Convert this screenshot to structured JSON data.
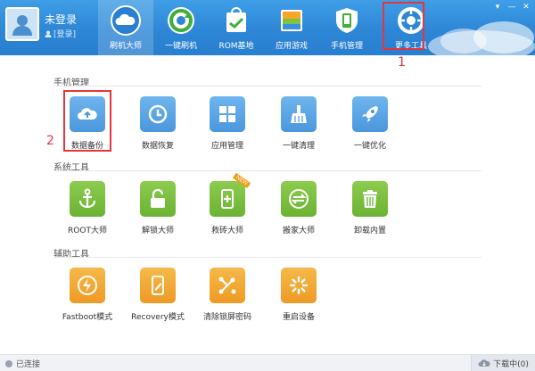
{
  "header": {
    "user_name": "未登录",
    "login_link": "[登录]",
    "tabs": [
      {
        "label": "刷机大师",
        "icon": "cloud-icon",
        "active": true
      },
      {
        "label": "一键刷机",
        "icon": "refresh-icon",
        "active": false
      },
      {
        "label": "ROM基地",
        "icon": "rom-bag-icon",
        "active": false
      },
      {
        "label": "应用游戏",
        "icon": "apps-icon",
        "active": false
      },
      {
        "label": "手机管理",
        "icon": "phone-shield-icon",
        "active": false
      },
      {
        "label": "更多工具",
        "icon": "gear-icon",
        "active": false
      }
    ],
    "window_controls": [
      "▾",
      "—",
      "✕"
    ]
  },
  "annotations": {
    "step1": "1",
    "step2": "2"
  },
  "sections": [
    {
      "title": "手机管理",
      "tools": [
        {
          "label": "数据备份",
          "icon": "cloud-upload-icon",
          "color": "#4a97dc"
        },
        {
          "label": "数据恢复",
          "icon": "clock-icon",
          "color": "#4a97dc"
        },
        {
          "label": "应用管理",
          "icon": "grid-icon",
          "color": "#4a97dc"
        },
        {
          "label": "一键清理",
          "icon": "broom-icon",
          "color": "#4a97dc"
        },
        {
          "label": "一键优化",
          "icon": "rocket-icon",
          "color": "#4a97dc"
        }
      ]
    },
    {
      "title": "系统工具",
      "tools": [
        {
          "label": "ROOT大师",
          "icon": "anchor-icon",
          "color": "#6bb233"
        },
        {
          "label": "解锁大师",
          "icon": "unlock-icon",
          "color": "#6bb233"
        },
        {
          "label": "救砖大师",
          "icon": "phone-plus-icon",
          "color": "#6bb233",
          "badge": "NEW"
        },
        {
          "label": "搬家大师",
          "icon": "transfer-icon",
          "color": "#6bb233"
        },
        {
          "label": "卸载内置",
          "icon": "trash-icon",
          "color": "#6bb233"
        }
      ]
    },
    {
      "title": "辅助工具",
      "tools": [
        {
          "label": "Fastboot模式",
          "icon": "lightning-icon",
          "color": "#ee9a24"
        },
        {
          "label": "Recovery模式",
          "icon": "phone-edit-icon",
          "color": "#ee9a24"
        },
        {
          "label": "清除锁屏密码",
          "icon": "pattern-lock-icon",
          "color": "#ee9a24"
        },
        {
          "label": "重启设备",
          "icon": "restart-icon",
          "color": "#ee9a24"
        }
      ]
    }
  ],
  "status": {
    "connection": "已连接",
    "download": "下载中(0)"
  }
}
